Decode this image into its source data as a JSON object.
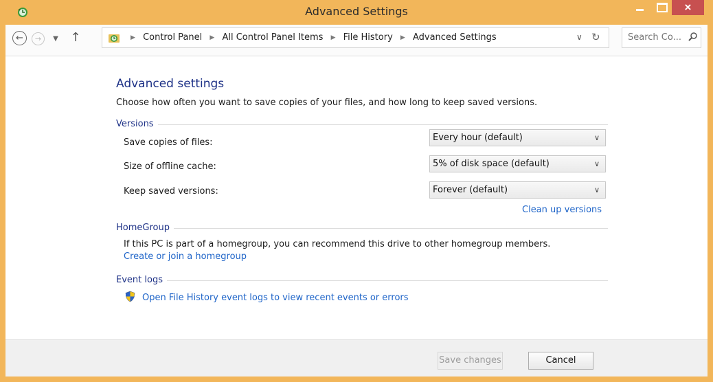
{
  "window": {
    "title": "Advanced Settings",
    "close_glyph": "×",
    "accent_color": "#f2b65a"
  },
  "navigation": {
    "back_icon": "back-arrow-icon",
    "forward_icon": "forward-arrow-icon",
    "up_icon": "up-arrow-icon",
    "breadcrumbs": [
      "Control Panel",
      "All Control Panel Items",
      "File History",
      "Advanced Settings"
    ],
    "search_placeholder": "Search Co..."
  },
  "main": {
    "heading": "Advanced settings",
    "description": "Choose how often you want to save copies of your files, and how long to keep saved versions.",
    "versions": {
      "label": "Versions",
      "save_copies_label": "Save copies of files:",
      "save_copies_value": "Every hour (default)",
      "offline_cache_label": "Size of offline cache:",
      "offline_cache_value": "5% of disk space (default)",
      "keep_versions_label": "Keep saved versions:",
      "keep_versions_value": "Forever (default)",
      "cleanup_link": "Clean up versions"
    },
    "homegroup": {
      "label": "HomeGroup",
      "text": "If this PC is part of a homegroup, you can recommend this drive to other homegroup members.",
      "link": "Create or join a homegroup"
    },
    "event_logs": {
      "label": "Event logs",
      "link": "Open File History event logs to view recent events or errors"
    }
  },
  "footer": {
    "save_label": "Save changes",
    "cancel_label": "Cancel"
  },
  "colors": {
    "heading": "#1e3287",
    "link": "#1e64c8",
    "close": "#c75050"
  }
}
